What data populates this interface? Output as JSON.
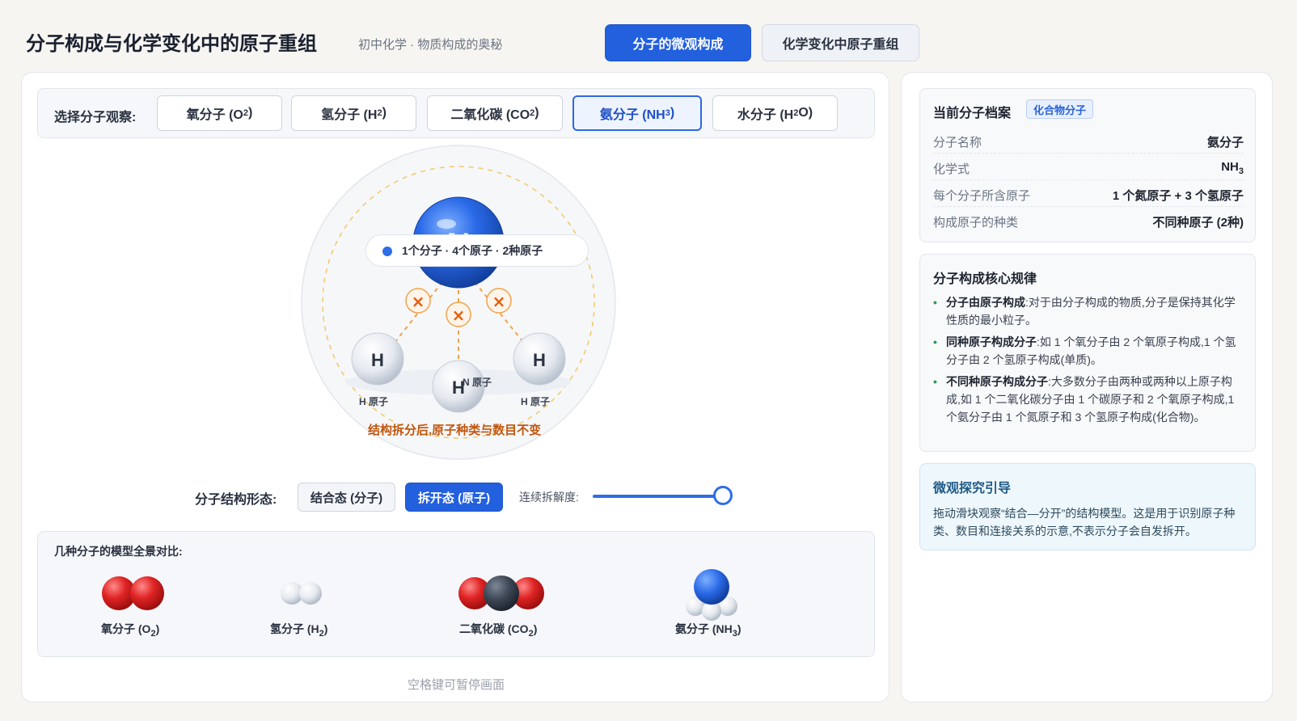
{
  "header": {
    "title": "分子构成与化学变化中的原子重组",
    "subtitle": "初中化学 · 物质构成的奥秘",
    "tabs": [
      {
        "label": "分子的微观构成",
        "active": true
      },
      {
        "label": "化学变化中原子重组",
        "active": false
      }
    ]
  },
  "selector": {
    "label": "选择分子观察:",
    "molecules": [
      {
        "name": "氧分子 (O",
        "sub": "2",
        "tail": ")",
        "active": false
      },
      {
        "name": "氢分子 (H",
        "sub": "2",
        "tail": ")",
        "active": false
      },
      {
        "name": "二氧化碳 (CO",
        "sub": "2",
        "tail": ")",
        "active": false
      },
      {
        "name": "氨分子 (NH",
        "sub": "3",
        "tail": ")",
        "active": true
      },
      {
        "name": "水分子 (H",
        "sub": "2",
        "tail": "O)",
        "active": false
      }
    ]
  },
  "stage": {
    "count_text": "1个分子 · 4个原子 · 2种原子",
    "center_symbol": "N",
    "center_label": "N 原子",
    "h_symbol": "H",
    "h_label": "H 原子",
    "split_note": "结构拆分后,原子种类与数目不变",
    "colors": {
      "nitrogen": "#2a6ae8",
      "hydrogen": "#e9edf3",
      "bond_break": "#e8731a"
    }
  },
  "controls": {
    "state_label": "分子结构形态:",
    "bonded_label": "结合态 (分子)",
    "split_label": "拆开态 (原子)",
    "split_active": true,
    "slider_label": "连续拆解度:",
    "slider_value": 1.0
  },
  "compare": {
    "title": "几种分子的模型全景对比:",
    "items": [
      {
        "name": "氧分子 (O",
        "sub": "2",
        "tail": ")"
      },
      {
        "name": "氢分子 (H",
        "sub": "2",
        "tail": ")"
      },
      {
        "name": "二氧化碳 (CO",
        "sub": "2",
        "tail": ")"
      },
      {
        "name": "氨分子 (NH",
        "sub": "3",
        "tail": ")"
      }
    ]
  },
  "hint": "空格键可暂停画面",
  "profile": {
    "title": "当前分子档案",
    "badge": "化合物分子",
    "rows": [
      {
        "key": "分子名称",
        "value": "氨分子"
      },
      {
        "key": "化学式",
        "value": "NH",
        "sub": "3"
      },
      {
        "key": "每个分子所含原子",
        "value": "1 个氮原子 + 3 个氢原子"
      },
      {
        "key": "构成原子的种类",
        "value": "不同种原子 (2种)"
      }
    ]
  },
  "rules": {
    "title": "分子构成核心规律",
    "items": [
      {
        "head": "分子由原子构成",
        "body": ":对于由分子构成的物质,分子是保持其化学性质的最小粒子。"
      },
      {
        "head": "同种原子构成分子",
        "body": ":如 1 个氧分子由 2 个氧原子构成,1 个氢分子由 2 个氢原子构成(单质)。"
      },
      {
        "head": "不同种原子构成分子",
        "body": ":大多数分子由两种或两种以上原子构成,如 1 个二氧化碳分子由 1 个碳原子和 2 个氧原子构成,1 个氨分子由 1 个氮原子和 3 个氢原子构成(化合物)。"
      }
    ]
  },
  "guide": {
    "title": "微观探究引导",
    "text": "拖动滑块观察“结合—分开”的结构模型。这是用于识别原子种类、数目和连接关系的示意,不表示分子会自发拆开。"
  }
}
